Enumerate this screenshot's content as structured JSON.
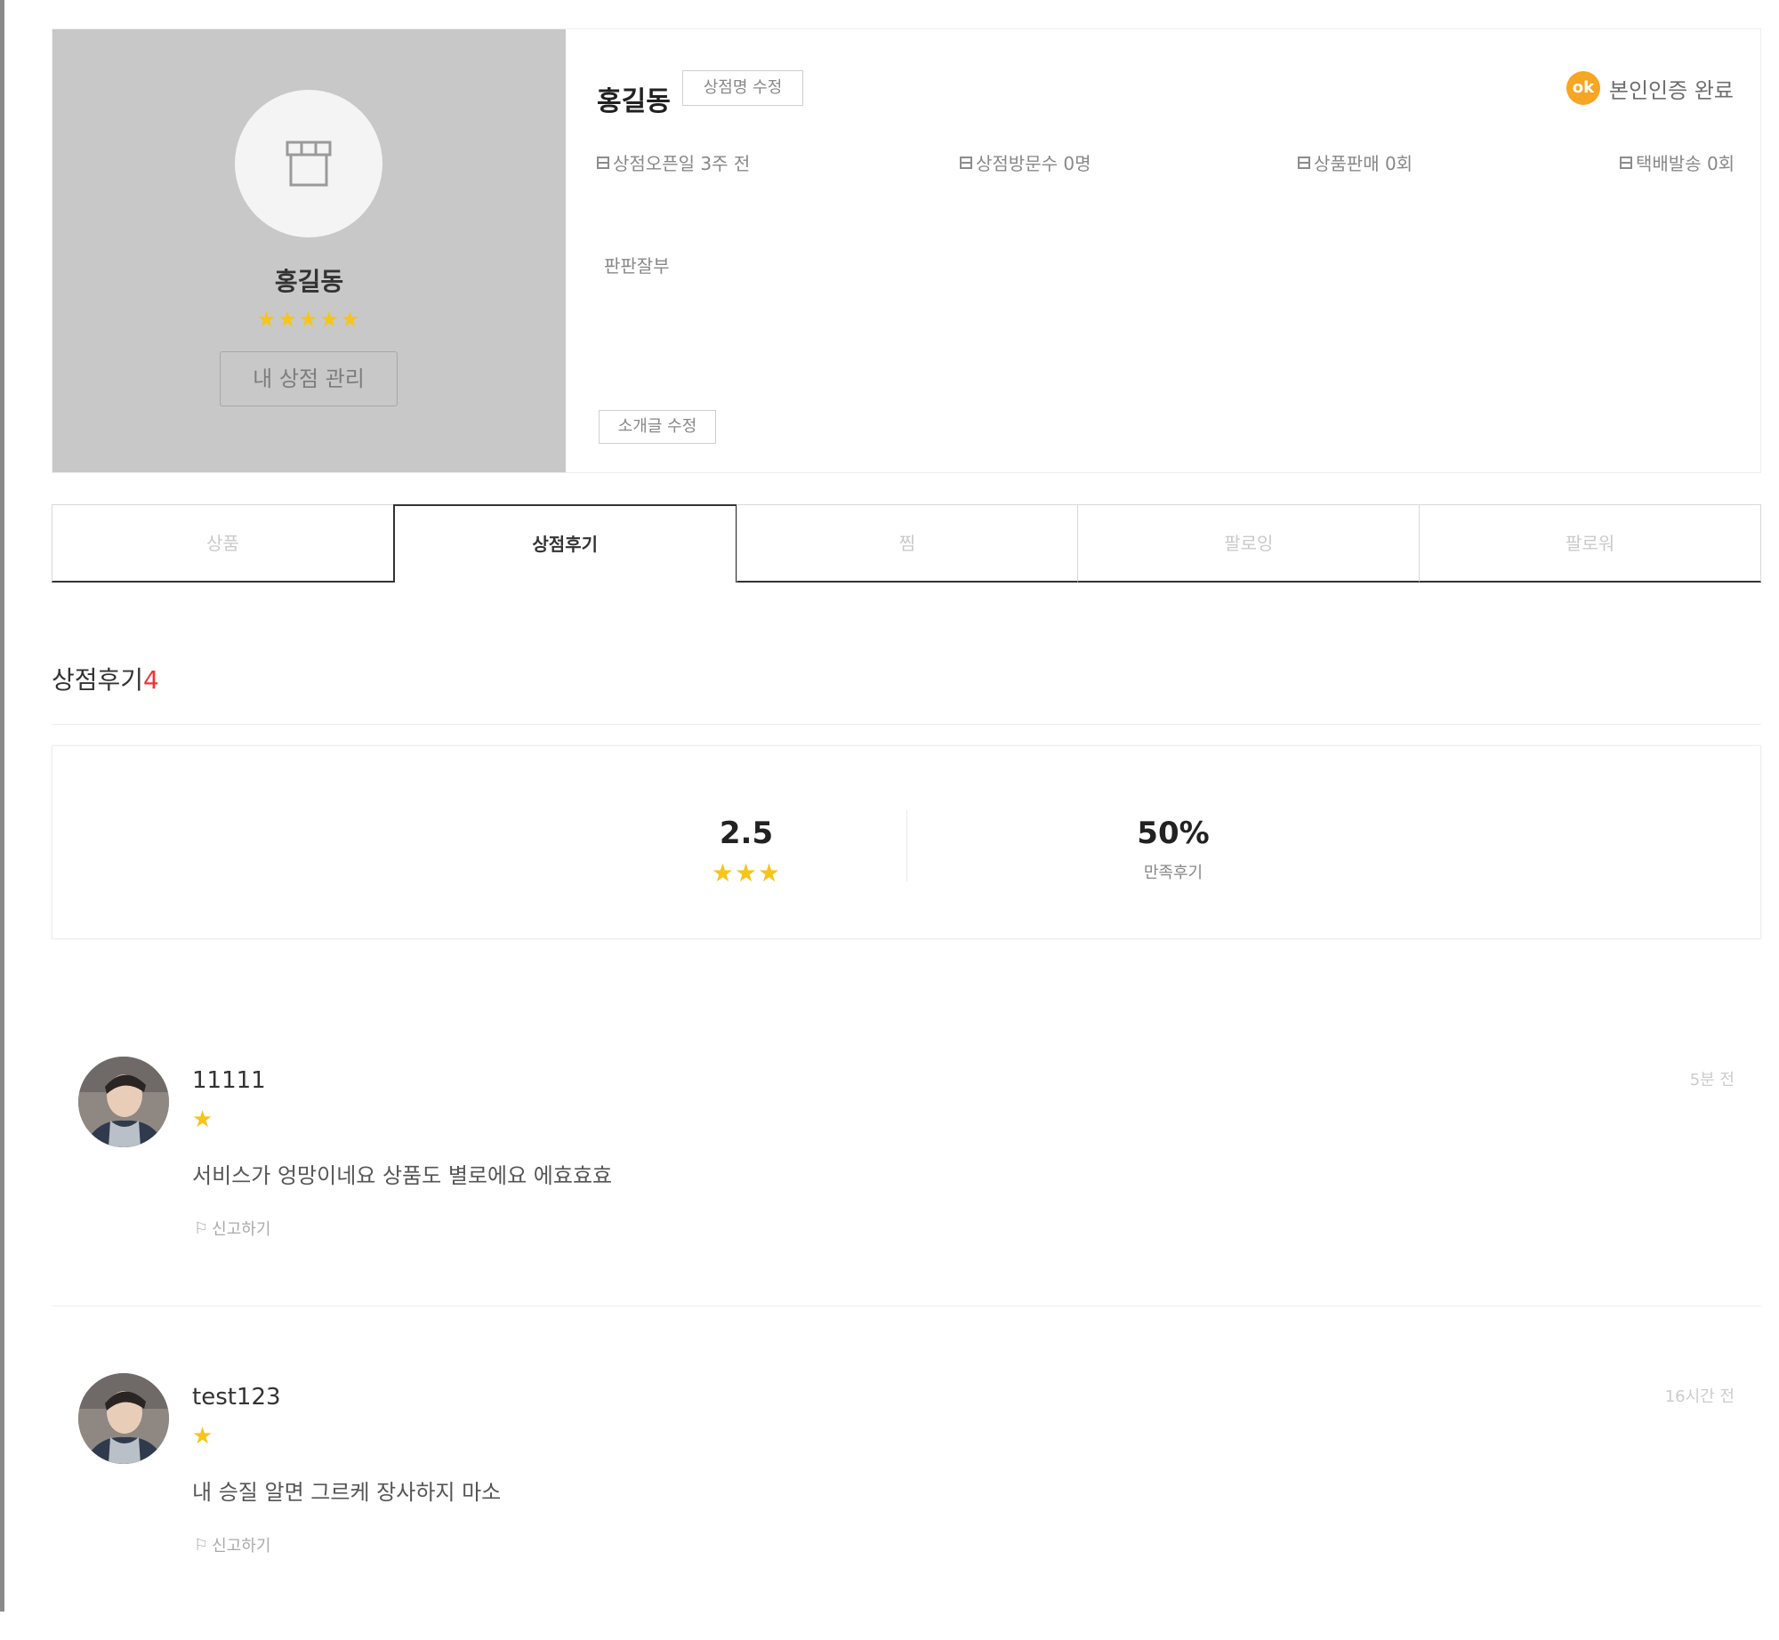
{
  "profile": {
    "name": "홍길동",
    "rating_stars": "★★★★★",
    "manage_button": "내 상점 관리",
    "edit_name_button": "상점명 수정",
    "verified_badge": "ok",
    "verified_label": "본인인증 완료",
    "stats": [
      {
        "icon": "calendar-icon",
        "label": "상점오픈일 3주 전"
      },
      {
        "icon": "visitors-icon",
        "label": "상점방문수 0명"
      },
      {
        "icon": "sales-icon",
        "label": "상품판매 0회"
      },
      {
        "icon": "delivery-icon",
        "label": "택배발송 0회"
      }
    ],
    "intro_text": "판판잘부",
    "edit_intro_button": "소개글 수정"
  },
  "tabs": [
    {
      "label": "상품",
      "active": false
    },
    {
      "label": "상점후기",
      "active": true
    },
    {
      "label": "찜",
      "active": false
    },
    {
      "label": "팔로잉",
      "active": false
    },
    {
      "label": "팔로워",
      "active": false
    }
  ],
  "reviews_section": {
    "title": "상점후기",
    "count": "4",
    "average_score": "2.5",
    "average_stars": "★★★",
    "satisfaction_percent": "50%",
    "satisfaction_label": "만족후기"
  },
  "reviews": [
    {
      "username": "11111",
      "time": "5분 전",
      "stars": "★",
      "text": "서비스가 엉망이네요 상품도 별로에요 에효효효",
      "report_label": "신고하기"
    },
    {
      "username": "test123",
      "time": "16시간 전",
      "stars": "★",
      "text": "내 승질 알면 그르케 장사하지 마소",
      "report_label": "신고하기"
    }
  ],
  "colors": {
    "accent_star": "#f5c518",
    "verified_orange": "#f5a623",
    "count_red": "#e53935",
    "profile_panel": "#c8c8c8"
  }
}
